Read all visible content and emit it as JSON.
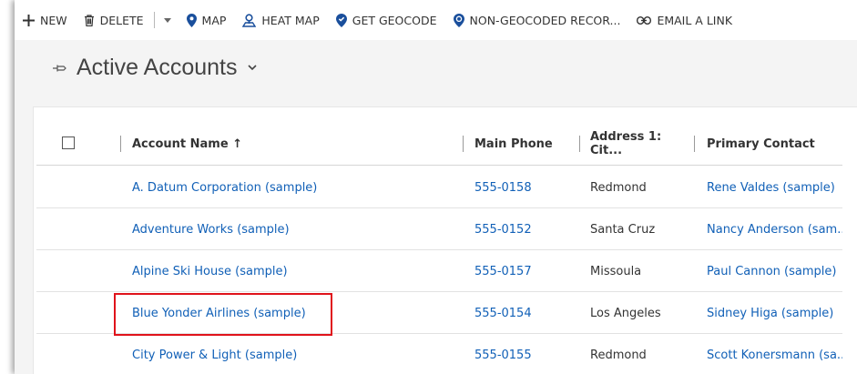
{
  "toolbar": {
    "new_label": "NEW",
    "delete_label": "DELETE",
    "map_label": "MAP",
    "heat_map_label": "HEAT MAP",
    "get_geocode_label": "GET GEOCODE",
    "non_geocoded_label": "NON-GEOCODED RECOR...",
    "email_link_label": "EMAIL A LINK"
  },
  "view": {
    "title": "Active Accounts"
  },
  "grid": {
    "columns": {
      "account_name": "Account Name ↑",
      "main_phone": "Main Phone",
      "address_city": "Address 1: Cit...",
      "primary_contact": "Primary Contact"
    },
    "rows": [
      {
        "name": "A. Datum Corporation (sample)",
        "phone": "555-0158",
        "city": "Redmond",
        "contact": "Rene Valdes (sample)"
      },
      {
        "name": "Adventure Works (sample)",
        "phone": "555-0152",
        "city": "Santa Cruz",
        "contact": "Nancy Anderson (sam..."
      },
      {
        "name": "Alpine Ski House (sample)",
        "phone": "555-0157",
        "city": "Missoula",
        "contact": "Paul Cannon (sample)"
      },
      {
        "name": "Blue Yonder Airlines (sample)",
        "phone": "555-0154",
        "city": "Los Angeles",
        "contact": "Sidney Higa (sample)"
      },
      {
        "name": "City Power & Light (sample)",
        "phone": "555-0155",
        "city": "Redmond",
        "contact": "Scott Konersmann (sa..."
      }
    ]
  },
  "colors": {
    "link": "#1160b7",
    "highlight": "#e0131b",
    "icon_blue": "#1a4f9c"
  }
}
